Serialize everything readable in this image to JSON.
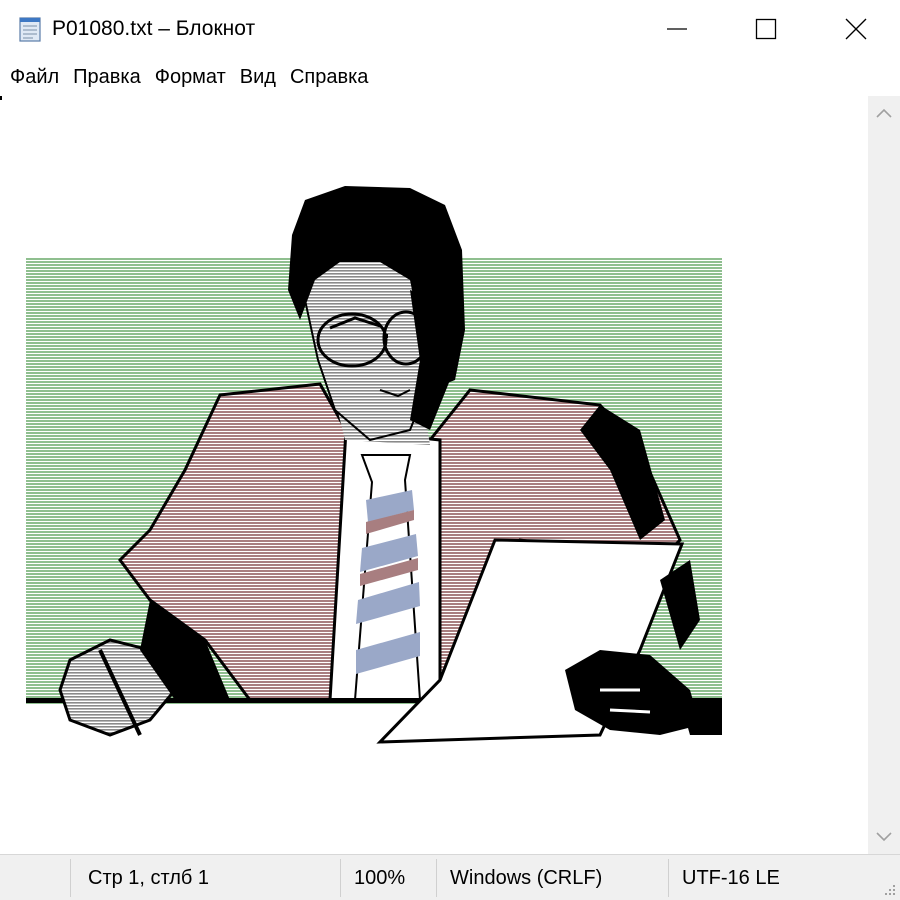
{
  "window": {
    "title": "P01080.txt – Блокнот",
    "icon": "notepad-icon",
    "controls": [
      "minimize-icon",
      "maximize-icon",
      "close-icon"
    ]
  },
  "menu": {
    "items": [
      {
        "label": "Файл"
      },
      {
        "label": "Правка"
      },
      {
        "label": "Формат"
      },
      {
        "label": "Вид"
      },
      {
        "label": "Справка"
      }
    ]
  },
  "editor": {
    "content": "ASCII-art illustration: businessman in glasses reading a sheet of paper at a desk"
  },
  "status": {
    "position": "Стр 1, стлб 1",
    "zoom": "100%",
    "line_ending": "Windows (CRLF)",
    "encoding": "UTF-16 LE"
  },
  "colors": {
    "background_green": "#9dc59d",
    "suit_mauve": "#b89090",
    "tie_blue": "#9aa8c8",
    "ink": "#000000",
    "chrome": "#f0f0f0"
  }
}
